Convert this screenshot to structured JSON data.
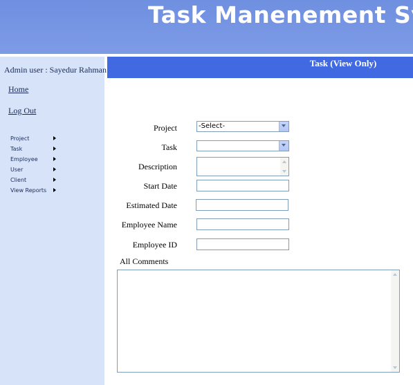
{
  "header": {
    "title": "Task Manenement System"
  },
  "sidebar": {
    "admin_label": "Admin user : Sayedur Rahman",
    "home": "Home",
    "logout": "Log Out",
    "menu": [
      {
        "label": "Project"
      },
      {
        "label": "Task"
      },
      {
        "label": "Employee"
      },
      {
        "label": "User"
      },
      {
        "label": "Client"
      },
      {
        "label": "View Reports"
      }
    ]
  },
  "main": {
    "title": "Task (View Only)",
    "form": {
      "project_label": "Project",
      "project_value": "-Select-",
      "task_label": "Task",
      "task_value": "",
      "description_label": "Description",
      "start_date_label": "Start Date",
      "estimated_date_label": "Estimated Date",
      "employee_name_label": "Employee Name",
      "employee_id_label": "Employee ID",
      "all_comments_label": "All Comments"
    }
  },
  "icons": {
    "menu_arrow": "triangle-right-icon",
    "dropdown": "chevron-down-icon"
  },
  "colors": {
    "header_bg": "#7391e3",
    "sidebar_bg": "#d6e3f8",
    "title_bar_bg": "#4169e1"
  }
}
